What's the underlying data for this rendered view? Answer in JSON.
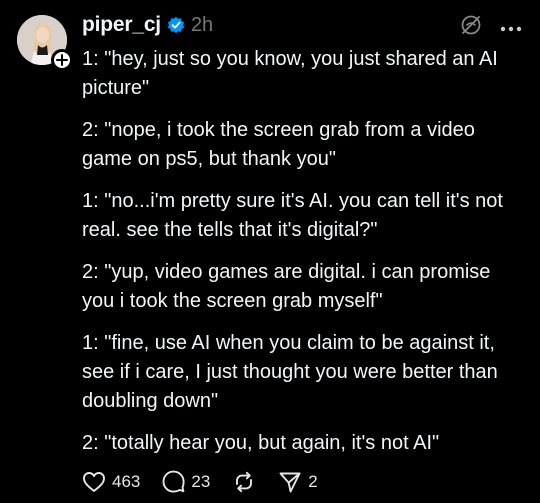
{
  "post": {
    "username": "piper_cj",
    "timestamp": "2h",
    "body": [
      "1: \"hey, just so you know, you just shared an AI picture\"",
      "2: \"nope, i took the screen grab from a video game on ps5, but thank you\"",
      "1: \"no...i'm pretty sure it's AI. you can tell it's not real. see the tells that it's digital?\"",
      "2: \"yup, video games are digital. i can promise you i took the screen grab myself\"",
      "1: \"fine, use AI when you claim to be against it, see if i care, I just thought you were better than doubling down\"",
      "2: \"totally hear you, but again, it's not AI\""
    ]
  },
  "actions": {
    "likes": "463",
    "replies": "23",
    "shares": "2"
  },
  "colors": {
    "background": "#000000",
    "text": "#f3f5f7",
    "muted": "#777777",
    "verified": "#0095f6"
  },
  "icons": {
    "verified": "verified-badge-icon",
    "mute": "mute-icon",
    "more": "more-options-icon",
    "like": "heart-icon",
    "reply": "comment-icon",
    "repost": "repost-icon",
    "share": "send-icon",
    "follow": "plus-icon"
  }
}
